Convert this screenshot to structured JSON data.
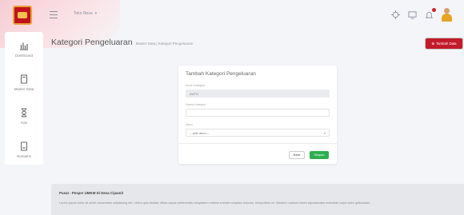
{
  "colors": {
    "brand": "#c21b2a",
    "accent_logo": "#e9a23b",
    "save": "#2eaf4f",
    "notification": "#d0202e"
  },
  "header": {
    "shop_menu_label": "Toko Nova",
    "icons": [
      "crosshair-icon",
      "screen-icon",
      "bell-icon"
    ]
  },
  "sidebar": {
    "items": [
      {
        "label": "Dashboard",
        "icon": "bar-chart-icon"
      },
      {
        "label": "Master Data",
        "icon": "book-icon"
      },
      {
        "label": "Kas",
        "icon": "hourglass-icon"
      },
      {
        "label": "Nomatrix",
        "icon": "document-icon"
      }
    ]
  },
  "page": {
    "title": "Kategori Pengeluaran",
    "breadcrumb": "Master Data | Kategori Pengeluaran",
    "add_button": "Tambah Data"
  },
  "form": {
    "title": "Tambah Kategori Pengeluaran",
    "code_label": "Kode Kategori",
    "code_value": "AUTO",
    "name_label": "Nama Kategori",
    "name_value": "",
    "status_label": "Akun",
    "status_selected": "-- pilih akun --",
    "reset_button": "Batal",
    "save_button": "Simpan"
  },
  "footer": {
    "title": "Pusat - Pesper UMKM Di Desa Cipamit",
    "text": "Lorem ipsum dolor sit amet consectetur adipisicing elit. Libero quis beatae officia saepe perferendis voluptatum minima eveniet voluptas dolorum, temporibus mi. Maxime nostrum totam repudiandae molestiae culpa dolor quibusdam."
  }
}
